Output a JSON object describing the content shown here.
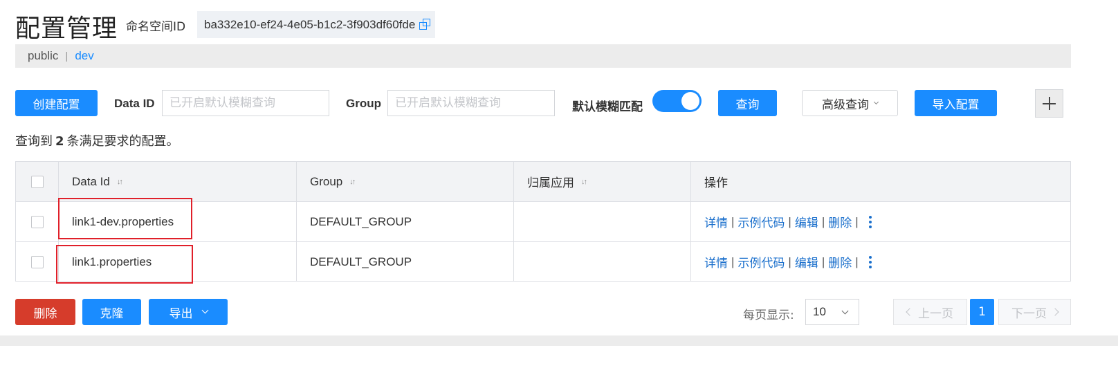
{
  "header": {
    "title": "配置管理",
    "namespace_label": "命名空间ID",
    "namespace_id": "ba332e10-ef24-4e05-b1c2-3f903df60fde"
  },
  "namespaces": {
    "items": [
      "public",
      "dev"
    ],
    "active": "dev",
    "separator": "|"
  },
  "toolbar": {
    "create_label": "创建配置",
    "data_id_label": "Data ID",
    "data_id_placeholder": "已开启默认模糊查询",
    "group_label": "Group",
    "group_placeholder": "已开启默认模糊查询",
    "fuzzy_label": "默认模糊匹配",
    "fuzzy_enabled": true,
    "query_label": "查询",
    "advanced_label": "高级查询",
    "import_label": "导入配置",
    "add_label": "+"
  },
  "result": {
    "prefix": "查询到",
    "count": "2",
    "suffix": "条满足要求的配置。"
  },
  "table": {
    "columns": [
      "Data Id",
      "Group",
      "归属应用",
      "操作"
    ],
    "rows": [
      {
        "data_id": "link1-dev.properties",
        "group": "DEFAULT_GROUP",
        "app": ""
      },
      {
        "data_id": "link1.properties",
        "group": "DEFAULT_GROUP",
        "app": ""
      }
    ],
    "actions": [
      "详情",
      "示例代码",
      "编辑",
      "删除"
    ],
    "action_sep": "|"
  },
  "footer": {
    "delete_label": "删除",
    "clone_label": "克隆",
    "export_label": "导出",
    "page_size_label": "每页显示:",
    "page_size": "10",
    "prev_label": "上一页",
    "current_page": "1",
    "next_label": "下一页"
  },
  "colors": {
    "primary": "#1a8cff",
    "danger": "#d63c2b",
    "highlight": "#e0202a"
  }
}
